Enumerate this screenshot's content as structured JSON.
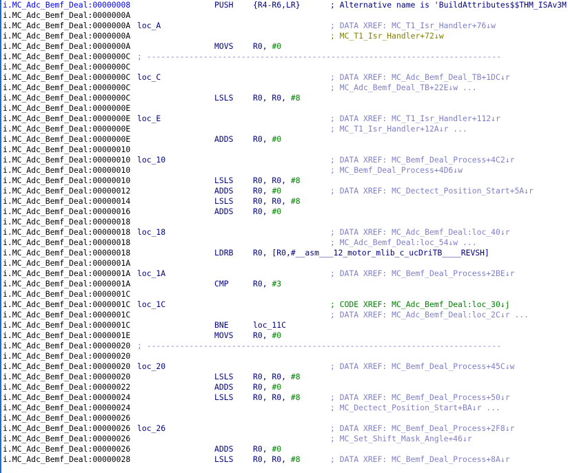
{
  "segment": "i.MC_Adc_Bemf_Deal",
  "separator": "; ---------------------------------------------------------------------------",
  "lines": [
    {
      "addr": "00000008",
      "mnem": "PUSH",
      "ops": "{R4-R6,LR}",
      "cmt": "; Alternative name is 'BuildAttributes$$THM_ISAv3M",
      "ctype": "dark",
      "current": true
    },
    {
      "addr": "0000000A"
    },
    {
      "addr": "0000000A",
      "label": "loc_A",
      "cmt": "; DATA XREF: MC_T1_Isr_Handler+76↓w"
    },
    {
      "addr": "0000000A",
      "cmt": "; MC_T1_Isr_Handler+72↓w",
      "ctype": "yellow"
    },
    {
      "addr": "0000000A",
      "mnem": "MOVS",
      "ops": "R0, ",
      "num": "#0"
    },
    {
      "addr": "0000000C",
      "sep": true
    },
    {
      "addr": "0000000C"
    },
    {
      "addr": "0000000C",
      "label": "loc_C",
      "cmt": "; DATA XREF: MC_Adc_Bemf_Deal_TB+1DC↓r"
    },
    {
      "addr": "0000000C",
      "cmt": "; MC_Adc_Bemf_Deal_TB+22E↓w ..."
    },
    {
      "addr": "0000000C",
      "mnem": "LSLS",
      "ops": "R0, R0, ",
      "num": "#8"
    },
    {
      "addr": "0000000E"
    },
    {
      "addr": "0000000E",
      "label": "loc_E",
      "cmt": "; DATA XREF: MC_T1_Isr_Handler+112↓r"
    },
    {
      "addr": "0000000E",
      "cmt": "; MC_T1_Isr_Handler+12A↓r ..."
    },
    {
      "addr": "0000000E",
      "mnem": "ADDS",
      "ops": "R0, ",
      "num": "#0"
    },
    {
      "addr": "00000010"
    },
    {
      "addr": "00000010",
      "label": "loc_10",
      "cmt": "; DATA XREF: MC_Bemf_Deal_Process+4C2↓r"
    },
    {
      "addr": "00000010",
      "cmt": "; MC_Bemf_Deal_Process+4D6↓w"
    },
    {
      "addr": "00000010",
      "mnem": "LSLS",
      "ops": "R0, R0, ",
      "num": "#8"
    },
    {
      "addr": "00000012",
      "mnem": "ADDS",
      "ops": "R0, ",
      "num": "#0",
      "cmt": "; DATA XREF: MC_Dectect_Position_Start+5A↓r"
    },
    {
      "addr": "00000014",
      "mnem": "LSLS",
      "ops": "R0, R0, ",
      "num": "#8"
    },
    {
      "addr": "00000016",
      "mnem": "ADDS",
      "ops": "R0, ",
      "num": "#0"
    },
    {
      "addr": "00000018"
    },
    {
      "addr": "00000018",
      "label": "loc_18",
      "cmt": "; DATA XREF: MC_Adc_Bemf_Deal:loc_40↓r"
    },
    {
      "addr": "00000018",
      "cmt": "; MC_Adc_Bemf_Deal:loc_54↓w ..."
    },
    {
      "addr": "00000018",
      "mnem": "LDRB",
      "ops": "R0, [R0,#__asm___12_motor_mlib_c_ucDriTB____REVSH]"
    },
    {
      "addr": "0000001A"
    },
    {
      "addr": "0000001A",
      "label": "loc_1A",
      "cmt": "; DATA XREF: MC_Bemf_Deal_Process+2BE↓r"
    },
    {
      "addr": "0000001A",
      "mnem": "CMP",
      "ops": "R0, ",
      "num": "#3"
    },
    {
      "addr": "0000001C"
    },
    {
      "addr": "0000001C",
      "label": "loc_1C",
      "cmt": "; CODE XREF: MC_Adc_Bemf_Deal:loc_30↓j",
      "ctype": "code"
    },
    {
      "addr": "0000001C",
      "cmt": "; DATA XREF: MC_Adc_Bemf_Deal:loc_2C↓r ..."
    },
    {
      "addr": "0000001C",
      "mnem": "BNE",
      "ops": "loc_11C"
    },
    {
      "addr": "0000001E",
      "mnem": "MOVS",
      "ops": "R0, ",
      "num": "#0"
    },
    {
      "addr": "00000020",
      "sep": true
    },
    {
      "addr": "00000020"
    },
    {
      "addr": "00000020",
      "label": "loc_20",
      "cmt": "; DATA XREF: MC_Bemf_Deal_Process+45C↓w"
    },
    {
      "addr": "00000020",
      "mnem": "LSLS",
      "ops": "R0, R0, ",
      "num": "#8"
    },
    {
      "addr": "00000022",
      "mnem": "ADDS",
      "ops": "R0, ",
      "num": "#0"
    },
    {
      "addr": "00000024",
      "mnem": "LSLS",
      "ops": "R0, R0, ",
      "num": "#8",
      "cmt": "; DATA XREF: MC_Bemf_Deal_Process+50↓r"
    },
    {
      "addr": "00000024",
      "cmt": "; MC_Dectect_Position_Start+BA↓r ..."
    },
    {
      "addr": "00000026"
    },
    {
      "addr": "00000026",
      "label": "loc_26",
      "cmt": "; DATA XREF: MC_Bemf_Deal_Process+2F8↓r"
    },
    {
      "addr": "00000026",
      "cmt": "; MC_Set_Shift_Mask_Angle+46↓r"
    },
    {
      "addr": "00000026",
      "mnem": "ADDS",
      "ops": "R0, ",
      "num": "#0"
    },
    {
      "addr": "00000028",
      "mnem": "LSLS",
      "ops": "R0, R0, ",
      "num": "#8",
      "cmt": "; DATA XREF: MC_Bemf_Deal_Process+8A↓r"
    }
  ]
}
